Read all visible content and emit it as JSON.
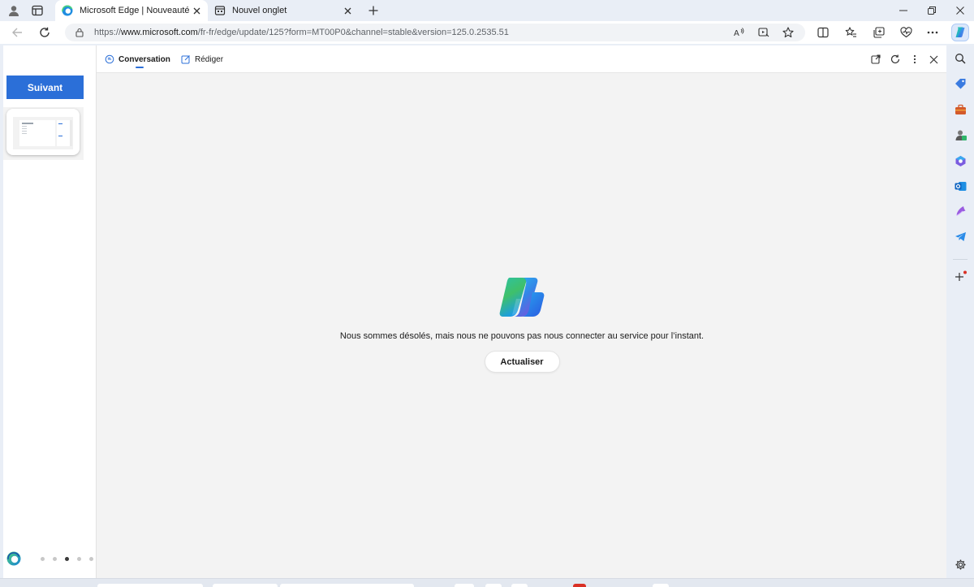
{
  "tabs": [
    {
      "title": "Microsoft Edge | Nouveautés",
      "active": true
    },
    {
      "title": "Nouvel onglet",
      "active": false
    }
  ],
  "address": {
    "prefix": "https://",
    "host": "www.microsoft.com",
    "path": "/fr-fr/edge/update/125?form=MT00P0&channel=stable&version=125.0.2535.51"
  },
  "page": {
    "next_label": "Suivant",
    "carousel_dots": 5,
    "active_dot": 2
  },
  "copilot": {
    "tabs": [
      {
        "label": "Conversation",
        "icon": "chat-icon",
        "active": true
      },
      {
        "label": "Rédiger",
        "icon": "compose-icon",
        "active": false
      }
    ],
    "error_message": "Nous sommes désolés, mais nous ne pouvons pas nous connecter au service pour l’instant.",
    "refresh_label": "Actualiser"
  },
  "sidebar": {
    "icons": [
      "search-icon",
      "shopping-tag-icon",
      "tools-icon",
      "games-icon",
      "microsoft365-icon",
      "outlook-icon",
      "drop-icon",
      "telegram-icon",
      "add-icon",
      "settings-icon"
    ]
  },
  "colors": {
    "accent": "#2b6fd8",
    "chrome": "#e9eef6",
    "pane_bg": "#f3f3f3"
  }
}
